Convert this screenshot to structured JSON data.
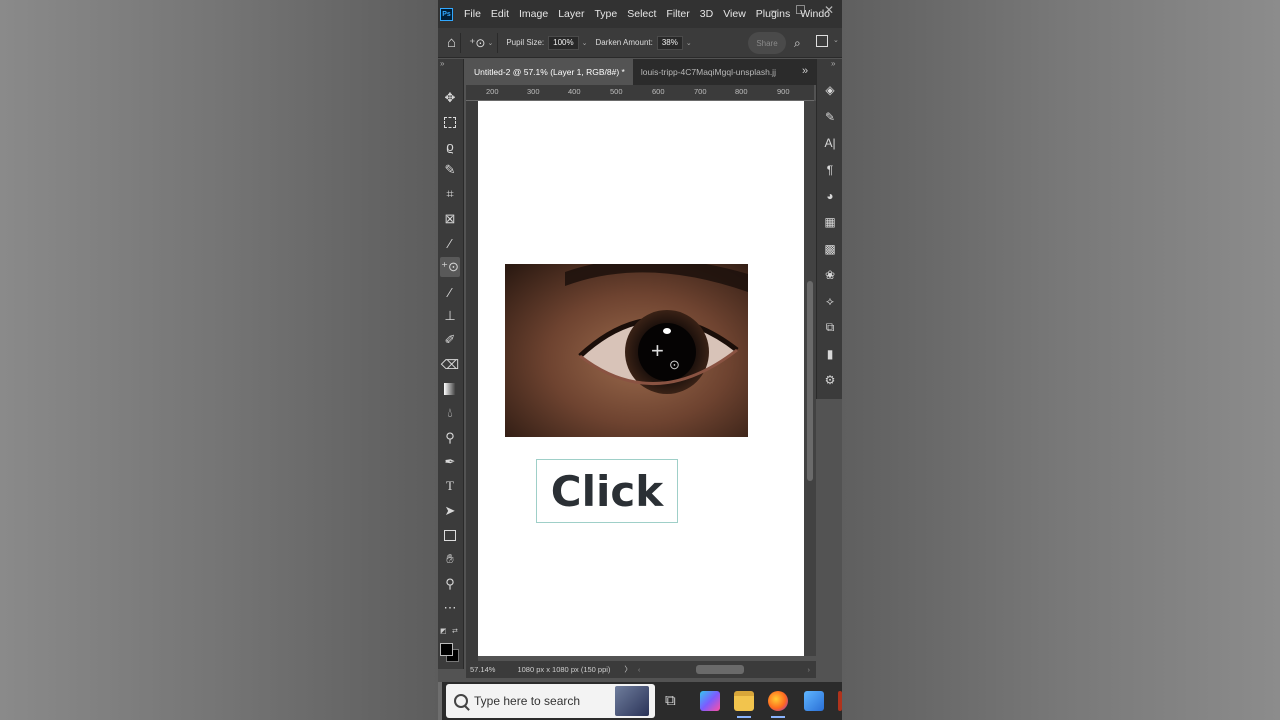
{
  "menubar": {
    "logo": "Ps",
    "items": [
      "File",
      "Edit",
      "Image",
      "Layer",
      "Type",
      "Select",
      "Filter",
      "3D",
      "View",
      "Plugins",
      "Windo"
    ]
  },
  "options": {
    "pupil_size_label": "Pupil Size:",
    "pupil_size_value": "100%",
    "darken_amount_label": "Darken Amount:",
    "darken_amount_value": "38%",
    "share_label": "Share"
  },
  "tabs": [
    {
      "label": "Untitled-2 @ 57.1% (Layer 1, RGB/8#) *",
      "close": "×"
    },
    {
      "label": "louis-tripp-4C7MaqiMgql-unsplash.jj"
    }
  ],
  "ruler": {
    "ticks": [
      "200",
      "300",
      "400",
      "500",
      "600",
      "700",
      "800",
      "900"
    ]
  },
  "canvas": {
    "text": "Click"
  },
  "status": {
    "zoom": "57.14%",
    "doc_info": "1080 px x 1080 px (150 ppi)",
    "arrow": "〉"
  },
  "taskbar": {
    "search_placeholder": "Type here to search"
  }
}
